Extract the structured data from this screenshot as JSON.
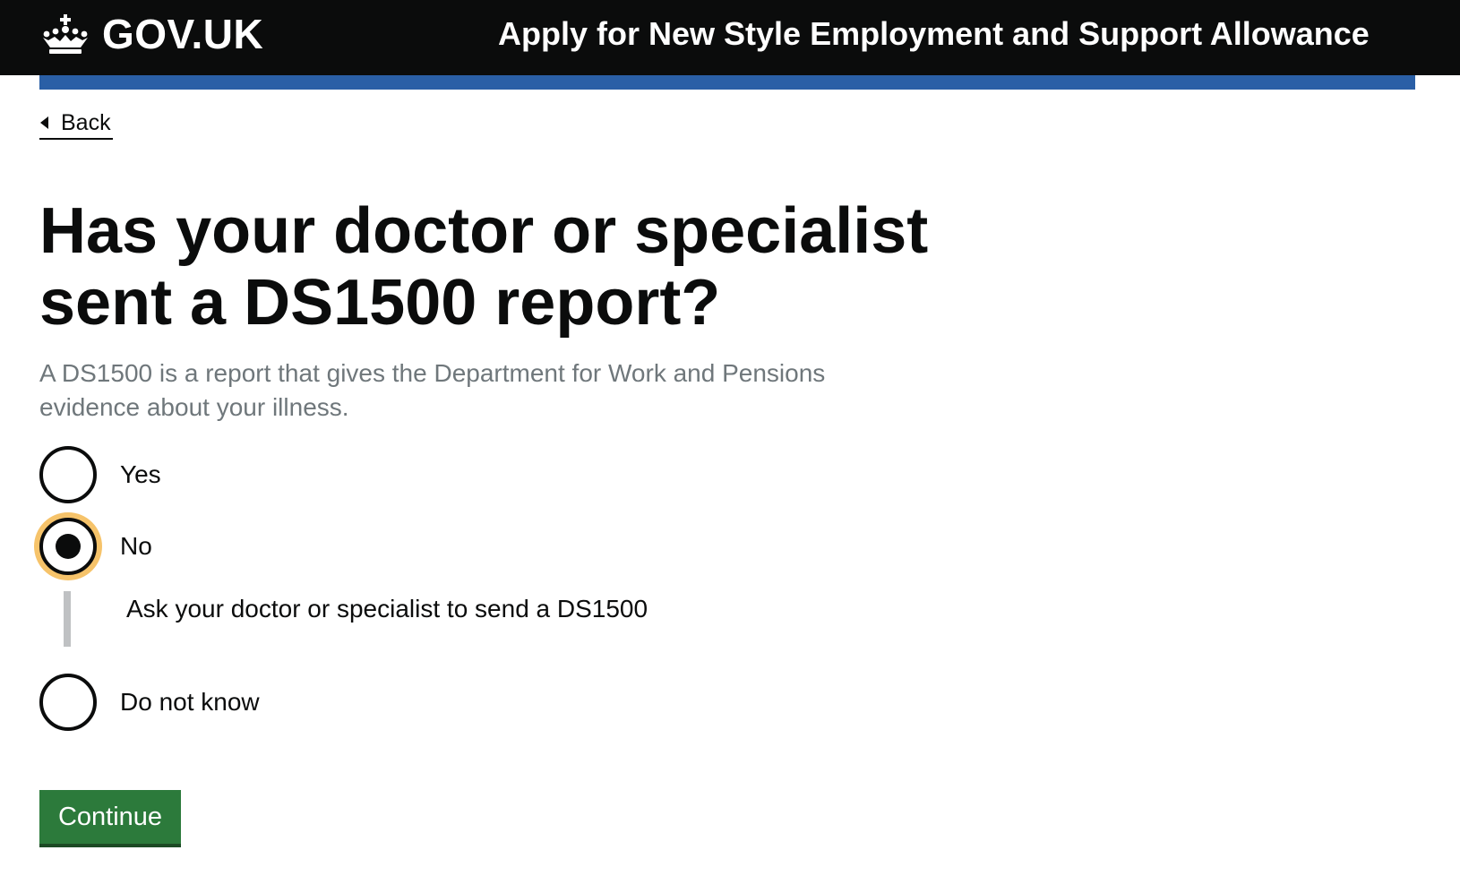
{
  "header": {
    "logo_text": "GOV.UK",
    "logo_icon": "crown-icon",
    "service_name": "Apply for New Style Employment and Support Allowance",
    "background_color": "#0b0c0c",
    "bar_color": "#2a5fa6"
  },
  "back_link": {
    "label": "Back",
    "icon": "chevron-left-icon"
  },
  "question": {
    "heading": "Has your doctor or specialist sent a DS1500 report?",
    "hint": "A DS1500 is a report that gives the Department for Work and Pensions evidence about your illness."
  },
  "radios": {
    "options": [
      {
        "label": "Yes",
        "checked": false
      },
      {
        "label": "No",
        "checked": true,
        "focused": true
      },
      {
        "label": "Do not know",
        "checked": false
      }
    ],
    "conditional_text": "Ask your doctor or specialist to send a DS1500",
    "focus_color": "#f6c36a"
  },
  "actions": {
    "continue_label": "Continue",
    "button_color": "#2c7a3b"
  }
}
